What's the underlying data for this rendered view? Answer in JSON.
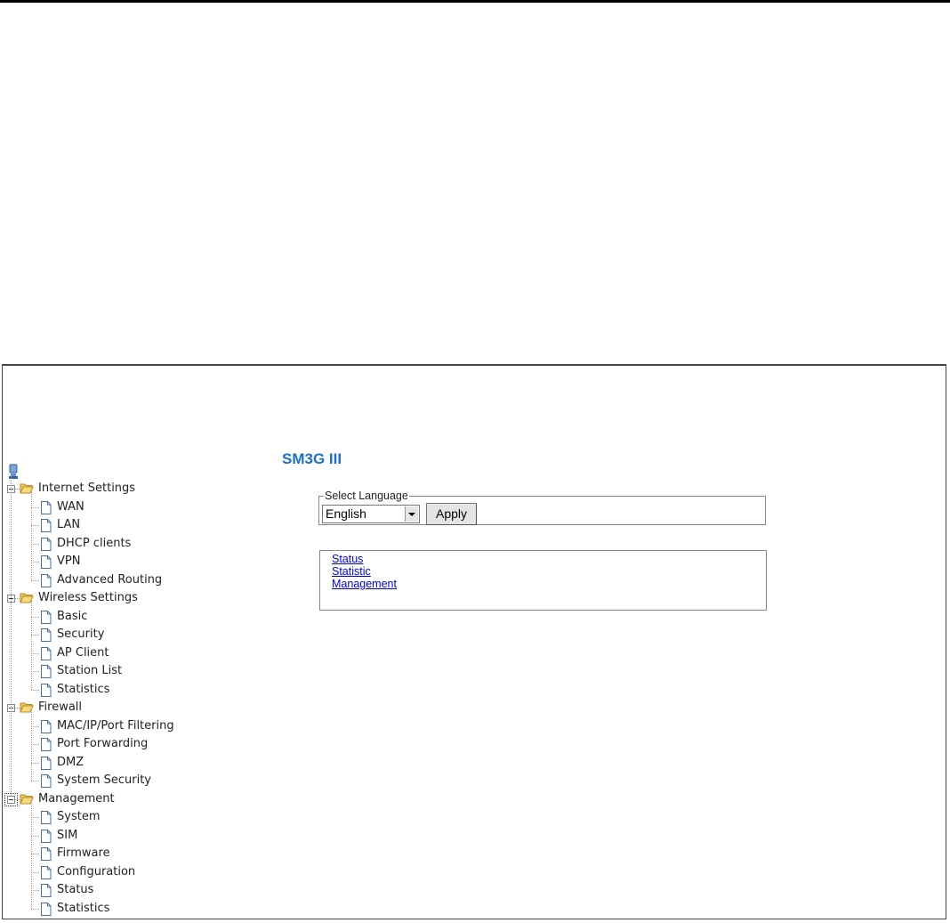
{
  "header": {
    "product_title": "SM3G III"
  },
  "language": {
    "legend": "Select Language",
    "selected": "English",
    "apply_label": "Apply"
  },
  "quick_links": [
    "Status",
    "Statistic",
    "Management"
  ],
  "tree": [
    {
      "label": "Internet Settings",
      "items": [
        "WAN",
        "LAN",
        "DHCP clients",
        "VPN",
        "Advanced Routing"
      ]
    },
    {
      "label": "Wireless Settings",
      "items": [
        "Basic",
        "Security",
        "AP Client",
        "Station List",
        "Statistics"
      ]
    },
    {
      "label": "Firewall",
      "items": [
        "MAC/IP/Port Filtering",
        "Port Forwarding",
        "DMZ",
        "System Security"
      ]
    },
    {
      "label": "Management",
      "items": [
        "System",
        "SIM",
        "Firmware",
        "Configuration",
        "Status",
        "Statistics"
      ]
    }
  ],
  "colors": {
    "title": "#1a6fd0",
    "link": "#0000ee",
    "folder": "#f3c94a"
  }
}
